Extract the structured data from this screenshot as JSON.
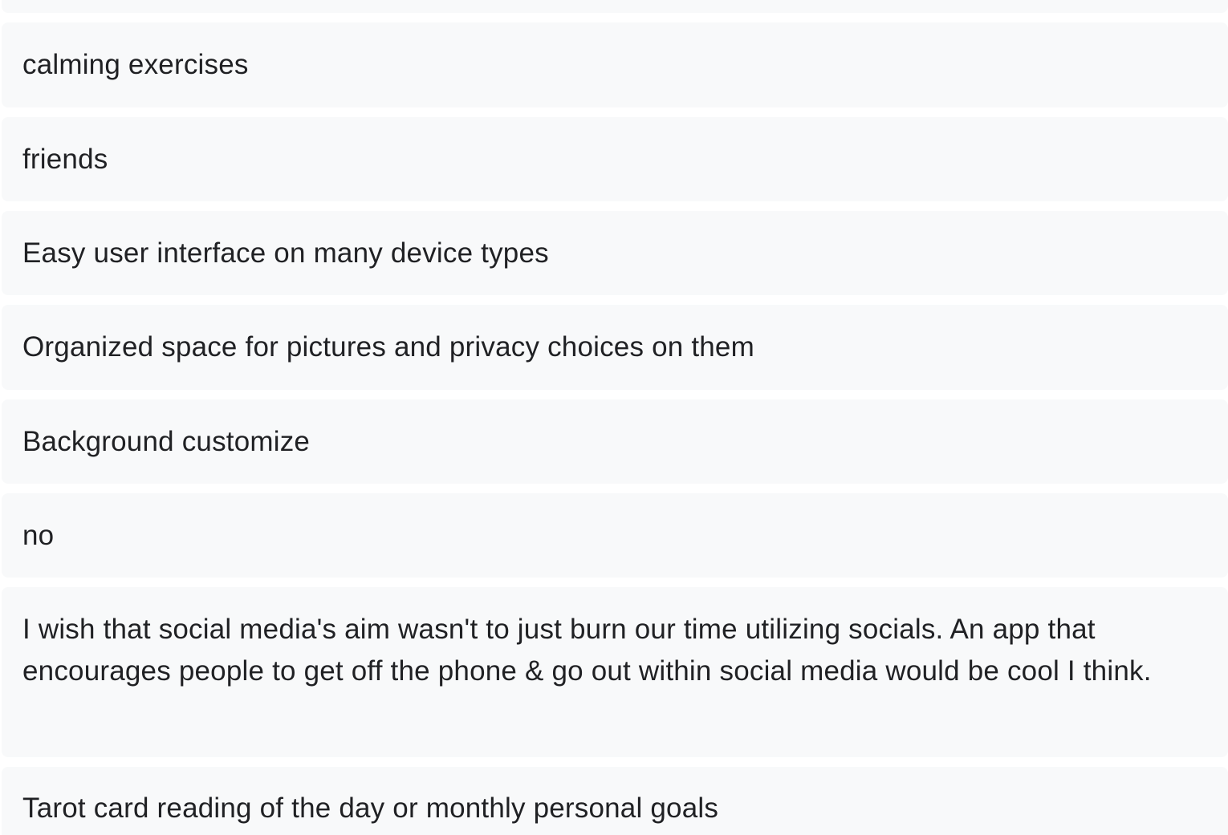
{
  "responses": [
    "",
    "calming exercises",
    "friends",
    "Easy user interface on many device types",
    "Organized space for pictures and privacy choices on them",
    "Background customize",
    "no",
    "I wish that social media's aim wasn't to just burn our time utilizing socials. An app that encourages people to get off the phone & go out within social media would be cool I think.",
    "Tarot card reading of the day or monthly personal goals"
  ]
}
